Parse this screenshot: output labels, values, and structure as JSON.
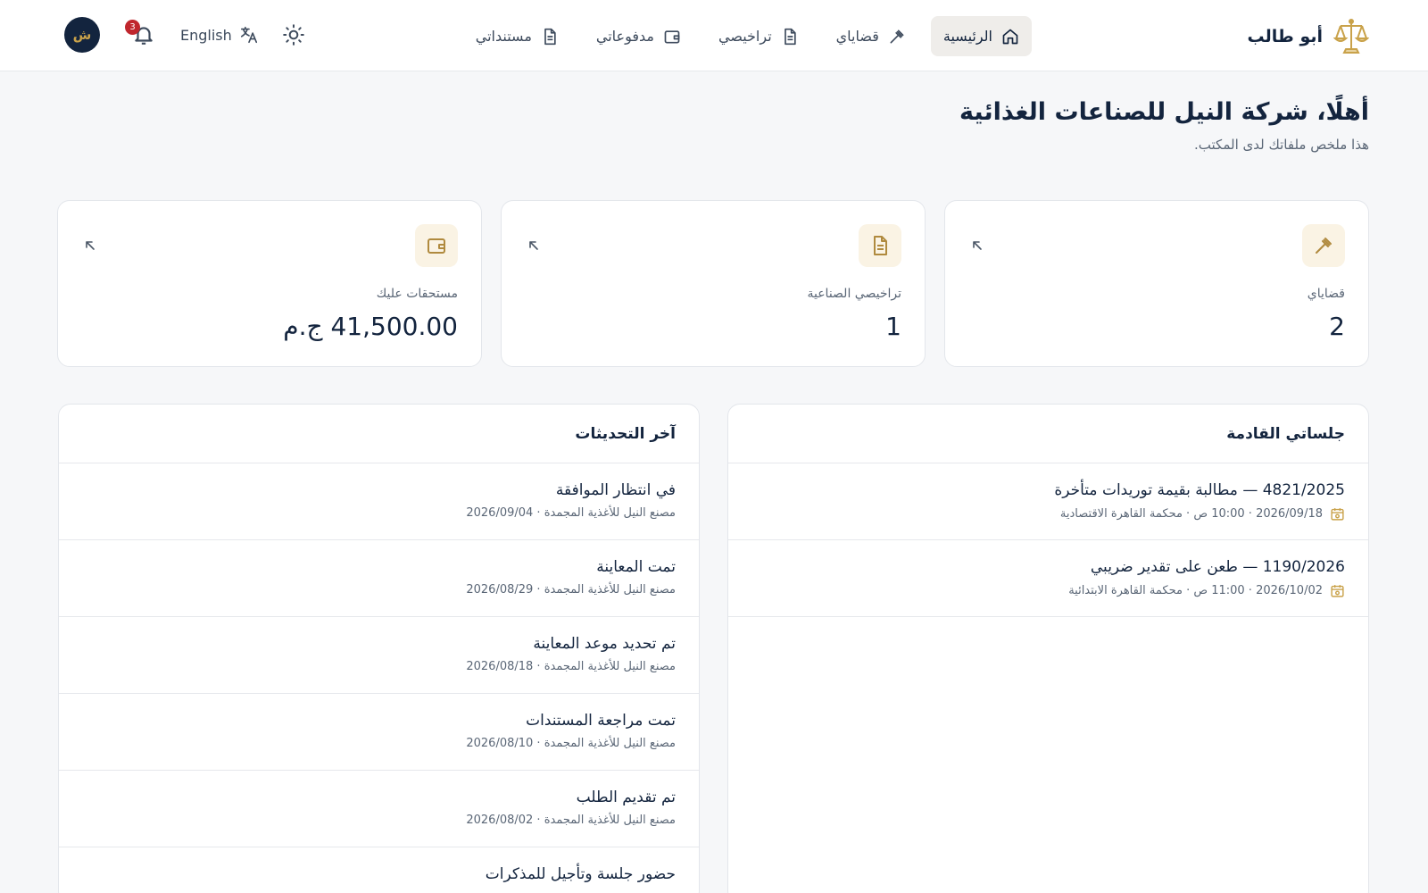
{
  "brand": {
    "name": "أبو طالب"
  },
  "nav": {
    "items": [
      {
        "label": "الرئيسية",
        "icon": "home-icon",
        "active": true
      },
      {
        "label": "قضاياي",
        "icon": "gavel-icon",
        "active": false
      },
      {
        "label": "تراخيصي",
        "icon": "document-icon",
        "active": false
      },
      {
        "label": "مدفوعاتي",
        "icon": "wallet-icon",
        "active": false
      },
      {
        "label": "مستنداتي",
        "icon": "document-icon",
        "active": false
      }
    ]
  },
  "tools": {
    "avatar_initial": "ش",
    "notifications_count": "3",
    "language_label": "English"
  },
  "greeting": {
    "title": "أهلًا، شركة النيل للصناعات الغذائية",
    "subtitle": "هذا ملخص ملفاتك لدى المكتب."
  },
  "stats": [
    {
      "label": "قضاياي",
      "value": "2",
      "icon": "gavel-icon"
    },
    {
      "label": "تراخيصي الصناعية",
      "value": "1",
      "icon": "document-icon"
    },
    {
      "label": "مستحقات عليك",
      "value": "41,500.00 ج.م",
      "icon": "wallet-icon"
    }
  ],
  "sessions": {
    "title": "جلساتي القادمة",
    "items": [
      {
        "title": "4821/2025 — مطالبة بقيمة توريدات متأخرة",
        "meta": "2026/09/18 · 10:00 ص · محكمة القاهرة الاقتصادية"
      },
      {
        "title": "1190/2026 — طعن على تقدير ضريبي",
        "meta": "2026/10/02 · 11:00 ص · محكمة القاهرة الابتدائية"
      }
    ]
  },
  "updates": {
    "title": "آخر التحديثات",
    "items": [
      {
        "title": "في انتظار الموافقة",
        "meta": "مصنع النيل للأغذية المجمدة · 2026/09/04"
      },
      {
        "title": "تمت المعاينة",
        "meta": "مصنع النيل للأغذية المجمدة · 2026/08/29"
      },
      {
        "title": "تم تحديد موعد المعاينة",
        "meta": "مصنع النيل للأغذية المجمدة · 2026/08/18"
      },
      {
        "title": "تمت مراجعة المستندات",
        "meta": "مصنع النيل للأغذية المجمدة · 2026/08/10"
      },
      {
        "title": "تم تقديم الطلب",
        "meta": "مصنع النيل للأغذية المجمدة · 2026/08/02"
      },
      {
        "title": "حضور جلسة وتأجيل للمذكرات",
        "meta": ""
      }
    ]
  },
  "colors": {
    "navy": "#13243e",
    "gold": "#c9a24a",
    "badge_red": "#c0262d",
    "background": "#f6f7f9"
  }
}
